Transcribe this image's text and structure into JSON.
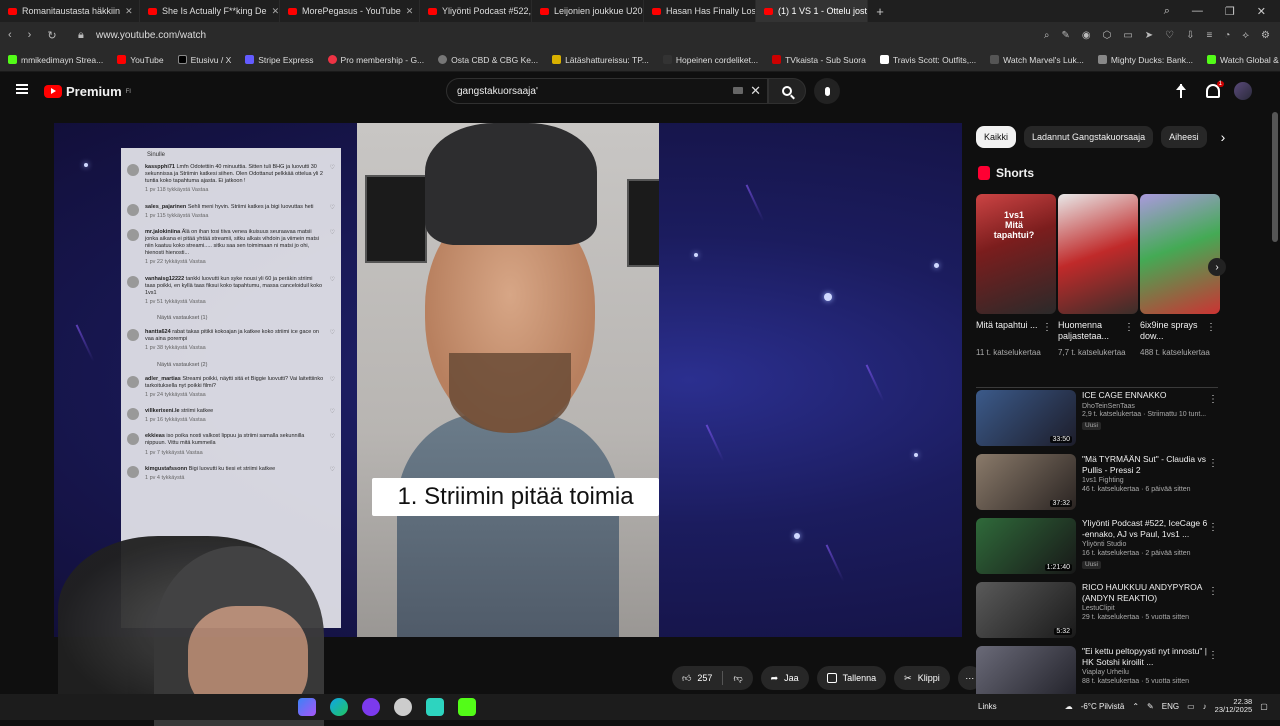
{
  "browser": {
    "tabs": [
      {
        "label": "Romanitaustasta häkkiin"
      },
      {
        "label": "She Is Actually F**king De"
      },
      {
        "label": "MorePegasus - YouTube"
      },
      {
        "label": "Yliyönti Podcast #522, Ice"
      },
      {
        "label": "Leijonien joukkue U20 MM"
      },
      {
        "label": "Hasan Has Finally Lost Hi"
      },
      {
        "label": "(1) 1 VS 1 - Ottelu jost"
      }
    ],
    "url": "www.youtube.com/watch",
    "bookmarks": [
      {
        "label": "mmikedimayn Strea..."
      },
      {
        "label": "YouTube"
      },
      {
        "label": "Etusivu / X"
      },
      {
        "label": "Stripe Express"
      },
      {
        "label": "Pro membership - G..."
      },
      {
        "label": "Osta CBD & CBG Ke..."
      },
      {
        "label": "Lätäshattureissu: TP..."
      },
      {
        "label": "Hopeinen cordeliket..."
      },
      {
        "label": "TVkaista - Sub Suora"
      },
      {
        "label": "Travis Scott: Outfits,..."
      },
      {
        "label": "Watch Marvel's Luk..."
      },
      {
        "label": "Mighty Ducks: Bank..."
      },
      {
        "label": "Watch Global & Loc..."
      }
    ]
  },
  "youtube": {
    "brand": "Premium",
    "brand_sup": "FI",
    "search_value": "gangstakuorsaaja'",
    "notification_count": "1"
  },
  "video": {
    "caption": "1. Striimin pitää toimia",
    "comments_header": "Sinulle",
    "comments": [
      {
        "user": "kasspphi71",
        "text": "Lmfn Odotettiin 40 minuuttia. Sitten tuli BHG ja luovutti 30 sekunnissa ja Striimin katkesi siihen. Olen Odottanut pelkkää ottelua yli 2 tuntia koko tapahtuma ajasta. Ei jatkoon !",
        "meta": "1 pv   118 tykkäystä   Vastaa"
      },
      {
        "user": "sales_pajarinen",
        "text": "Sehli meni hyvin. Striimi katkes ja bigi luovuttas heti",
        "meta": "1 pv   115 tykkäystä   Vastaa"
      },
      {
        "user": "mr.jalokiniina",
        "text": "Älä on ihan tosi tiiva venea ikuisuus seuraavaa matsii jonka aikana ei pitää yhtää streamii, sitku alkais vihdoin ja viimein matsi niin kaatuu koko streami..... sitku saa sen toimimaan ni matsi jo ohi, hienosti hienosti...",
        "meta": "1 pv   22 tykkäystä   Vastaa"
      },
      {
        "user": "vanhaisg12222",
        "text": "tankki luovutti kun syke nousi yli 60 ja peräkin striimi taas poikki, en kyllä taas fiksui koko tapahtumu, massa canceloiduil koko 1vs1",
        "meta": "1 pv   51 tykkäystä   Vastaa"
      },
      {
        "user": "hantta624",
        "text": "rabat takas pitikii kokoajan ja katkee koko striimi ice gace on vaa aina porempi",
        "meta": "1 pv   38 tykkäystä   Vastaa"
      },
      {
        "user": "adler_martias",
        "text": "Streami poikki, näytti sitä et Biggie luovutti? Vai laitettiinko tarkoituksella nyt poikki filmi?",
        "meta": "1 pv   24 tykkäystä   Vastaa"
      },
      {
        "user": "villkerixeni.le",
        "text": "striimi katkee",
        "meta": "1 pv   16 tykkäystä   Vastaa"
      },
      {
        "user": "ekkieas",
        "text": "iso poika nosti valkost lippuu ja striimi samalla sekunnilla nippuun. Vittu mitä kummeila",
        "meta": "1 pv   7 tykkäystä   Vastaa"
      },
      {
        "user": "kimgustafssonn",
        "text": "Bigi luovutti ku tiesi et striimi katkee",
        "meta": "1 pv   4 tykkäystä"
      }
    ],
    "replies": [
      "Näytä vastaukset (1)",
      "Näytä vastaukset (2)"
    ]
  },
  "actions": {
    "likes": "257",
    "share": "Jaa",
    "save": "Tallenna",
    "clip": "Klippi"
  },
  "sidebar": {
    "chips": [
      "Kaikki",
      "Ladannut Gangstakuorsaaja",
      "Aiheesi"
    ],
    "shorts_title": "Shorts",
    "shorts": [
      {
        "overlay": "1vs1\nMitä tapahtui?",
        "title": "Mitä tapahtui ...",
        "views": "11 t. katselukertaa"
      },
      {
        "overlay": "",
        "title": "Huomenna paljastetaa...",
        "views": "7,7 t. katselukertaa"
      },
      {
        "overlay": "",
        "title": "6ix9ine sprays dow...",
        "views": "488 t. katselukertaa"
      }
    ],
    "videos": [
      {
        "title": "ICE CAGE ENNAKKO",
        "channel": "DhoTeinSenTaas",
        "meta": "2,9 t. katselukertaa · Striimattu 10 tunt...",
        "badge": "Uusi",
        "duration": "33:50"
      },
      {
        "title": "\"Mä TYRMÄÄN Sut\" - Claudia vs Pullis - Pressi 2",
        "channel": "1vs1 Fighting",
        "meta": "46 t. katselukertaa · 6 päivää sitten",
        "badge": "",
        "duration": "37:32"
      },
      {
        "title": "Yliyönti Podcast #522, IceCage 6 -ennako, AJ vs Paul, 1vs1 ...",
        "channel": "Yliyönti Studio",
        "meta": "16 t. katselukertaa · 2 päivää sitten",
        "badge": "Uusi",
        "duration": "1:21:40"
      },
      {
        "title": "RICO HAUKKUU ANDYPYROA (ANDYN REAKTIO)",
        "channel": "LestuClipit",
        "meta": "29 t. katselukertaa · 5 vuotta sitten",
        "badge": "",
        "duration": "5:32"
      },
      {
        "title": "\"Ei kettu peltopyysti nyt innostu\" | HK Sotshi kiroilit ...",
        "channel": "Viaplay Urheilu",
        "meta": "88 t. katselukertaa · 5 vuotta sitten",
        "badge": "",
        "duration": ""
      }
    ]
  },
  "taskbar": {
    "links": "Links",
    "weather": "-6°C Pilvistä",
    "lang": "ENG",
    "time": "22.38",
    "date": "23/12/2025"
  }
}
